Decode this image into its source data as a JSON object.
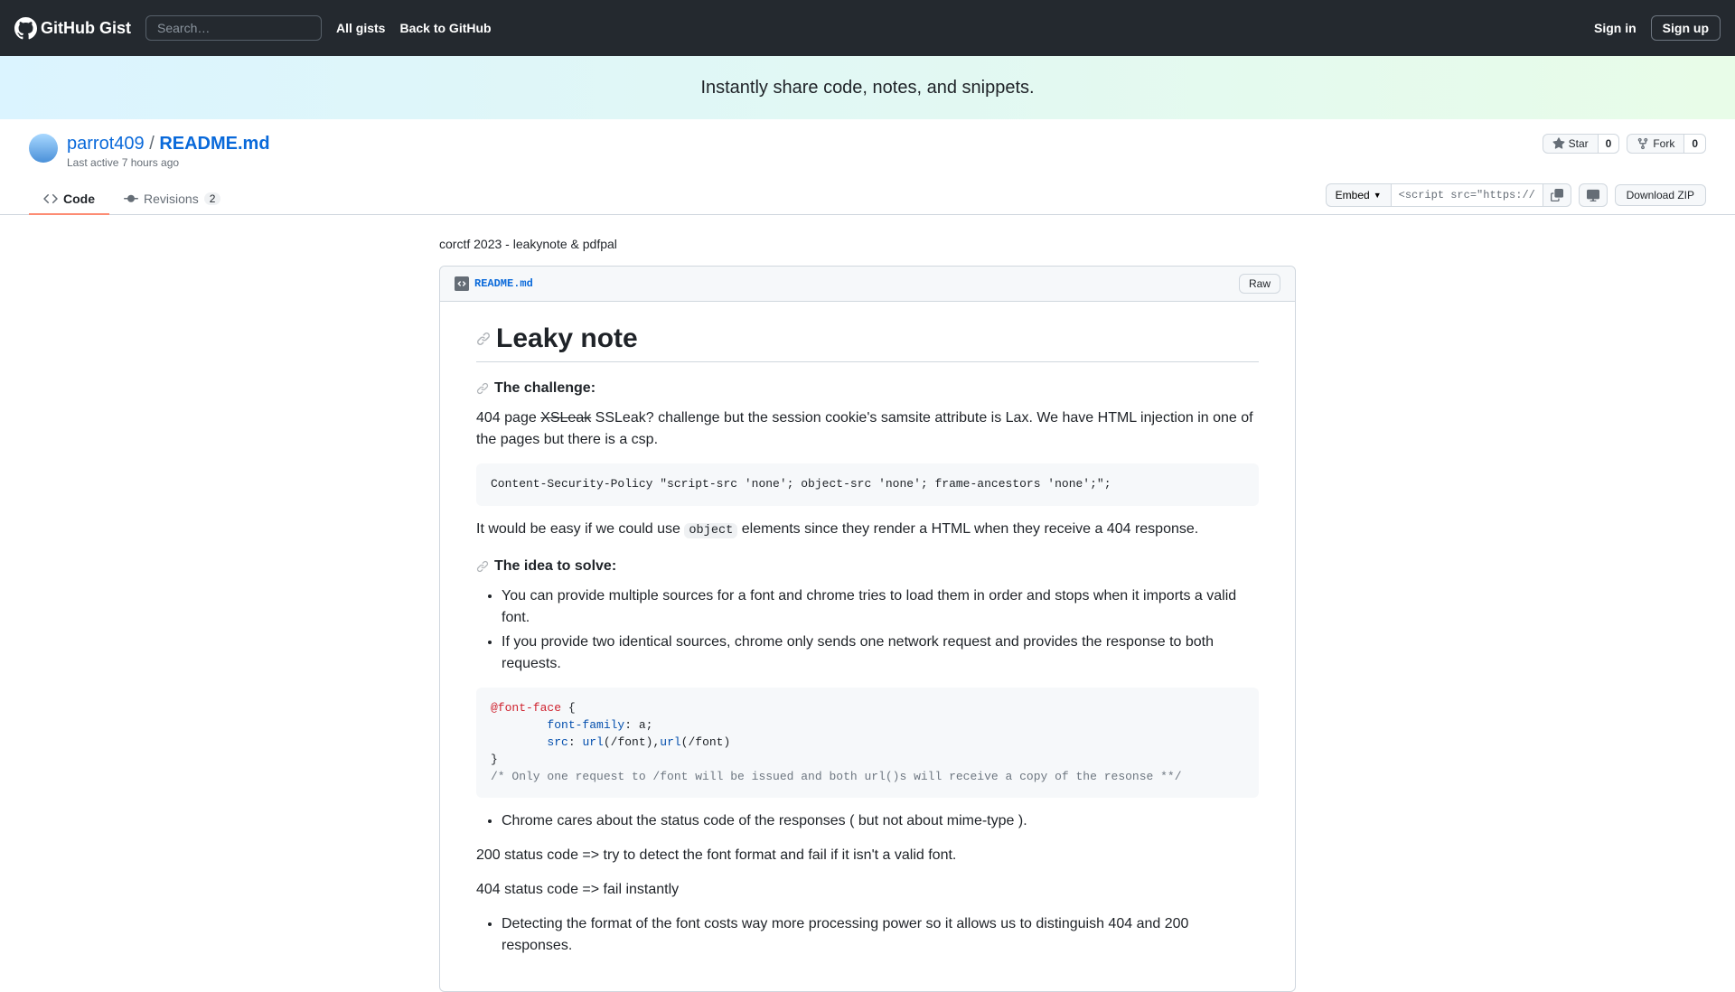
{
  "header": {
    "logo_text": "GitHub Gist",
    "search_placeholder": "Search…",
    "nav": {
      "all_gists": "All gists",
      "back": "Back to GitHub"
    },
    "signin": "Sign in",
    "signup": "Sign up"
  },
  "banner": {
    "tagline": "Instantly share code, notes, and snippets."
  },
  "gist": {
    "user": "parrot409",
    "sep": "/",
    "file": "README.md",
    "last_active": "Last active 7 hours ago",
    "star_label": "Star",
    "star_count": "0",
    "fork_label": "Fork",
    "fork_count": "0"
  },
  "tabs": {
    "code": "Code",
    "revisions": "Revisions",
    "rev_count": "2",
    "embed": "Embed",
    "url_value": "<script src=\"https://g",
    "download": "Download ZIP"
  },
  "content": {
    "desc": "corctf 2023 - leakynote & pdfpal",
    "file_name": "README.md",
    "raw": "Raw",
    "h1": "Leaky note",
    "h_challenge": "The challenge:",
    "p1a": "404 page ",
    "p1_strike": "XSLeak",
    "p1b": " SSLeak? challenge but the session cookie's samsite attribute is Lax. We have HTML injection in one of the pages but there is a csp.",
    "code1": "Content-Security-Policy \"script-src 'none'; object-src 'none'; frame-ancestors 'none';\";",
    "p2a": "It would be easy if we could use ",
    "p2_code": "object",
    "p2b": " elements since they render a HTML when they receive a 404 response.",
    "h_idea": "The idea to solve:",
    "li1": "You can provide multiple sources for a font and chrome tries to load them in order and stops when it imports a valid font.",
    "li2": "If you provide two identical sources, chrome only sends one network request and provides the response to both requests.",
    "code2": {
      "at": "@font-face",
      "open": " {",
      "indent1": "        ",
      "prop1": "font-family",
      "val1": ": a;",
      "indent2": "        ",
      "prop2": "src",
      "colon": ": ",
      "url1": "url",
      "arg1": "(/font),",
      "url2": "url",
      "arg2": "(/font)",
      "close": "}",
      "comment": "/* Only one request to /font will be issued and both url()s will receive a copy of the resonse **/"
    },
    "li3": "Chrome cares about the status code of the responses ( but not about mime-type ).",
    "p3": "200 status code => try to detect the font format and fail if it isn't a valid font.",
    "p4": "404 status code => fail instantly",
    "li4": "Detecting the format of the font costs way more processing power so it allows us to distinguish 404 and 200 responses."
  }
}
